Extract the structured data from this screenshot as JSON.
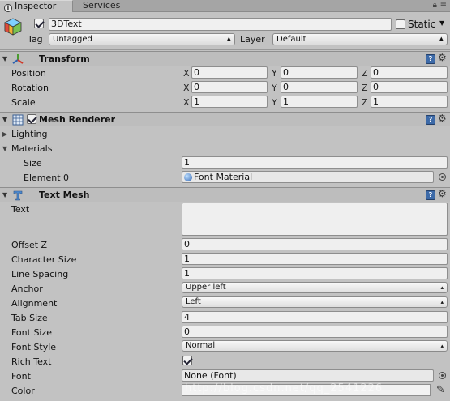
{
  "tabs": {
    "inspector": "Inspector",
    "services": "Services"
  },
  "gameobject": {
    "name": "3DText",
    "active": true,
    "static_label": "Static",
    "tag_label": "Tag",
    "tag_value": "Untagged",
    "layer_label": "Layer",
    "layer_value": "Default"
  },
  "transform": {
    "title": "Transform",
    "rows": [
      {
        "label": "Position",
        "x": "0",
        "y": "0",
        "z": "0"
      },
      {
        "label": "Rotation",
        "x": "0",
        "y": "0",
        "z": "0"
      },
      {
        "label": "Scale",
        "x": "1",
        "y": "1",
        "z": "1"
      }
    ]
  },
  "axis": {
    "x": "X",
    "y": "Y",
    "z": "Z"
  },
  "mesh_renderer": {
    "title": "Mesh Renderer",
    "enabled": true,
    "lighting": "Lighting",
    "materials": "Materials",
    "size_label": "Size",
    "size_value": "1",
    "element0_label": "Element 0",
    "element0_value": "Font Material"
  },
  "text_mesh": {
    "title": "Text Mesh",
    "text_label": "Text",
    "offset_z_label": "Offset Z",
    "offset_z": "0",
    "char_size_label": "Character Size",
    "char_size": "1",
    "line_spacing_label": "Line Spacing",
    "line_spacing": "1",
    "anchor_label": "Anchor",
    "anchor": "Upper left",
    "alignment_label": "Alignment",
    "alignment": "Left",
    "tab_size_label": "Tab Size",
    "tab_size": "4",
    "font_size_label": "Font Size",
    "font_size": "0",
    "font_style_label": "Font Style",
    "font_style": "Normal",
    "rich_text_label": "Rich Text",
    "rich_text": true,
    "font_label": "Font",
    "font": "None (Font)",
    "color_label": "Color",
    "color": "#f2f2f2"
  },
  "watermark": "http://blog.csdn.net/qq_2541226"
}
